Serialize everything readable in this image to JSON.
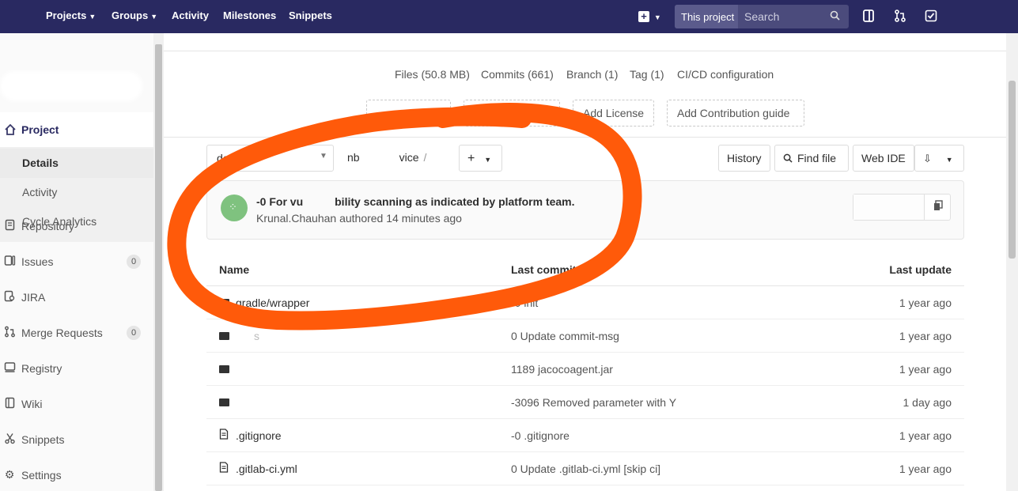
{
  "navbar": {
    "projects": "Projects",
    "groups": "Groups",
    "activity": "Activity",
    "milestones": "Milestones",
    "snippets": "Snippets",
    "search_scope": "This project",
    "search_placeholder": "Search"
  },
  "sidebar": {
    "project": "Project",
    "sub_items": [
      "Details",
      "Activity",
      "Cycle Analytics"
    ],
    "items": [
      {
        "label": "Repository",
        "icon": "book-icon"
      },
      {
        "label": "Issues",
        "icon": "issues-icon",
        "count": "0"
      },
      {
        "label": "JIRA",
        "icon": "jira-icon"
      },
      {
        "label": "Merge Requests",
        "icon": "merge-request-icon",
        "count": "0"
      },
      {
        "label": "Registry",
        "icon": "registry-icon"
      },
      {
        "label": "Wiki",
        "icon": "wiki-icon"
      },
      {
        "label": "Snippets",
        "icon": "snippets-icon"
      },
      {
        "label": "Settings",
        "icon": "settings-icon"
      }
    ]
  },
  "stats": {
    "files": "Files (50.8 MB)",
    "commits": "Commits (661)",
    "branch": "Branch (1)",
    "tag": "Tag (1)",
    "cicd": "CI/CD configuration"
  },
  "add_buttons": {
    "license": "Add License",
    "contribution": "Add Contribution guide"
  },
  "toolbar": {
    "branch": "develop",
    "path_prefix": "nb",
    "path_suffix": "vice",
    "history": "History",
    "find_file": "Find file",
    "web_ide": "Web IDE"
  },
  "last_commit": {
    "title_prefix": "-0 For vu",
    "title_suffix": "bility scanning as indicated by platform team.",
    "author": "Krunal.Chauhan",
    "meta": "authored 14 minutes ago"
  },
  "tree": {
    "col_name": "Name",
    "col_commit": "Last commit",
    "col_update": "Last update",
    "rows": [
      {
        "type": "folder",
        "name": "gradle/wrapper",
        "commit": "-0 init",
        "date": "1 year ago"
      },
      {
        "type": "folder",
        "name": "s",
        "commit": "0 Update commit-msg",
        "date": "1 year ago"
      },
      {
        "type": "folder",
        "name": "",
        "commit": "1189 jacocoagent.jar",
        "date": "1 year ago"
      },
      {
        "type": "folder",
        "name": "",
        "commit": "-3096 Removed parameter with Y",
        "date": "1 day ago"
      },
      {
        "type": "file",
        "name": ".gitignore",
        "commit": "-0 .gitignore",
        "date": "1 year ago"
      },
      {
        "type": "file",
        "name": ".gitlab-ci.yml",
        "commit": "0 Update .gitlab-ci.yml [skip ci]",
        "date": "1 year ago"
      }
    ]
  },
  "colors": {
    "navbar": "#292961",
    "annotation": "#ff5a0a",
    "avatar": "#7fc27f"
  }
}
